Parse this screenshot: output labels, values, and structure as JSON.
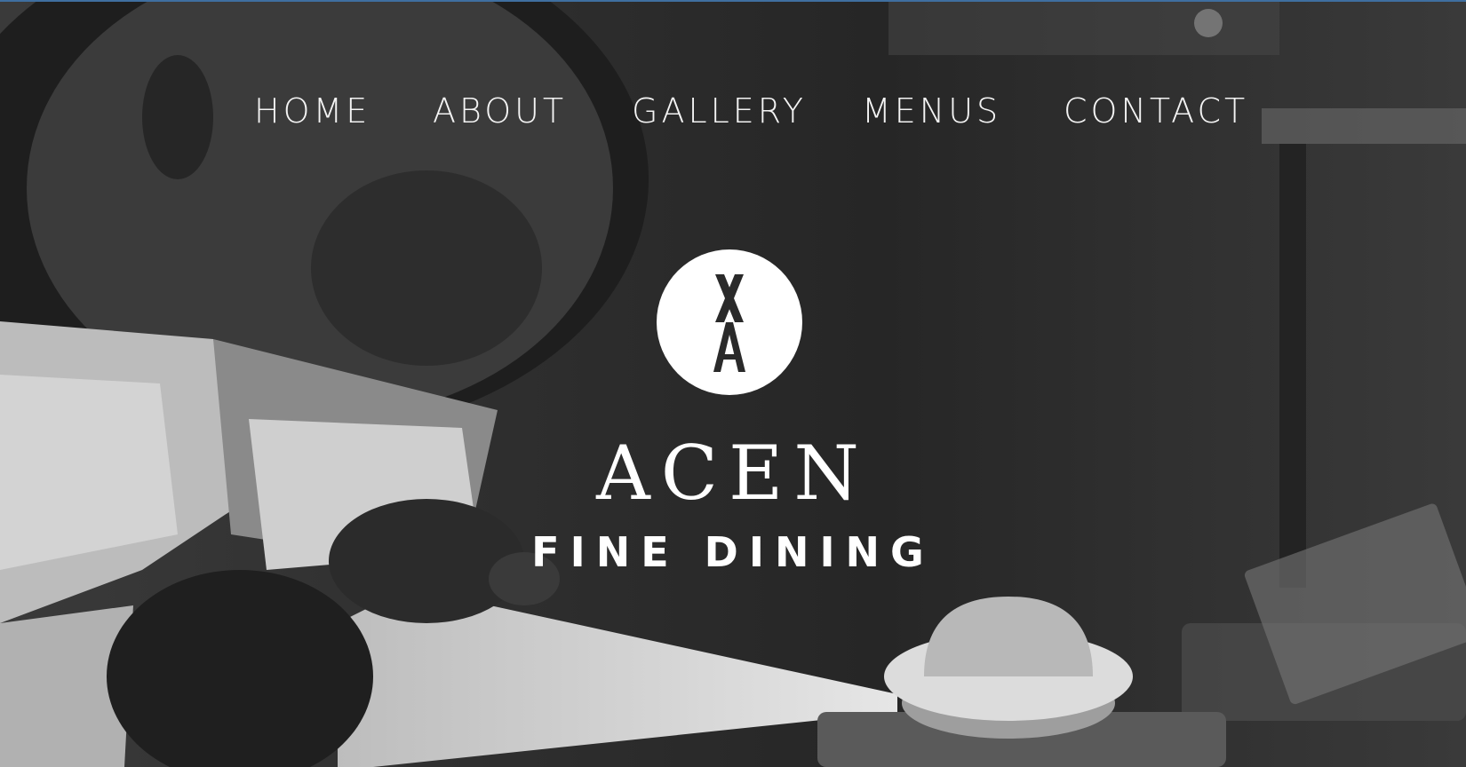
{
  "nav": {
    "items": [
      {
        "label": "HOME"
      },
      {
        "label": "ABOUT"
      },
      {
        "label": "GALLERY"
      },
      {
        "label": "MENUS"
      },
      {
        "label": "CONTACT"
      }
    ]
  },
  "hero": {
    "logo_icon": "xa-monogram-icon",
    "brand_name": "ACEN",
    "brand_tagline": "FINE DINING",
    "photo_subject": "chef-piping-dessert-photo"
  },
  "colors": {
    "top_border": "#3f6fa0",
    "text": "#ffffff",
    "overlay": "#2a2a2a"
  }
}
